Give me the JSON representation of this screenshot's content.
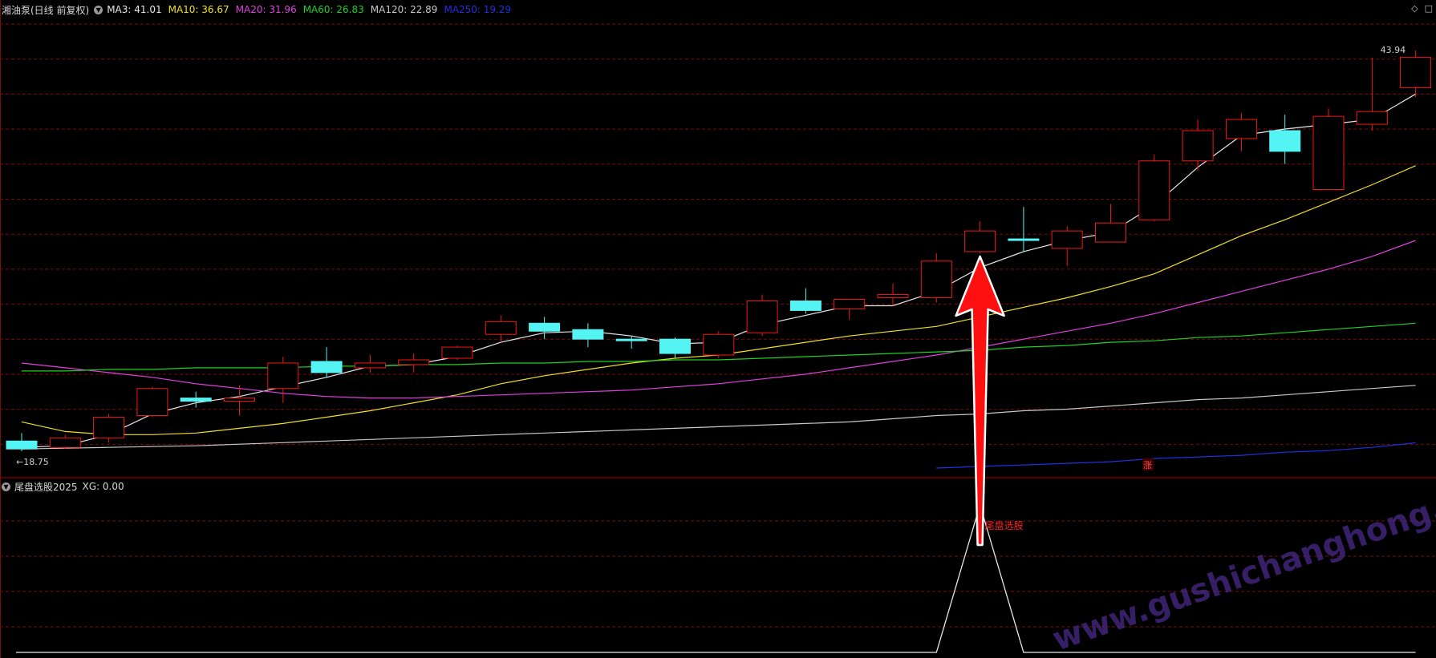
{
  "header": {
    "title": "湘油泵(日线 前复权)",
    "ma_labels": [
      {
        "name": "MA3",
        "value": "41.01",
        "color": "#e6e6e6"
      },
      {
        "name": "MA10",
        "value": "36.67",
        "color": "#f0e020"
      },
      {
        "name": "MA20",
        "value": "31.96",
        "color": "#e040e0"
      },
      {
        "name": "MA60",
        "value": "26.83",
        "color": "#20d020"
      },
      {
        "name": "MA120",
        "value": "22.89",
        "color": "#c8c8c8"
      },
      {
        "name": "MA250",
        "value": "19.29",
        "color": "#2030e0"
      }
    ]
  },
  "sub_panel": {
    "title": "尾盘选股2025",
    "xg_label": "XG: 0.00",
    "signal_text": "尾盘选股"
  },
  "annotations": {
    "high_label": "43.94",
    "low_label": "18.75",
    "rise_mark": "涨",
    "watermark": "www.gushichanghong.com"
  },
  "colors": {
    "up": "#f01818",
    "down": "#54f4f4",
    "grid": "#7a0a0a",
    "arrow": "#ff1010"
  },
  "chart_data": {
    "type": "candlestick",
    "ylim": [
      17.5,
      46
    ],
    "candles": [
      {
        "o": 19.4,
        "h": 19.9,
        "l": 18.75,
        "c": 18.9
      },
      {
        "o": 19.0,
        "h": 19.8,
        "l": 18.9,
        "c": 19.6
      },
      {
        "o": 19.6,
        "h": 21.1,
        "l": 19.3,
        "c": 20.9
      },
      {
        "o": 21.0,
        "h": 22.8,
        "l": 20.9,
        "c": 22.7
      },
      {
        "o": 22.1,
        "h": 22.5,
        "l": 21.5,
        "c": 21.9
      },
      {
        "o": 21.9,
        "h": 22.9,
        "l": 21.0,
        "c": 22.1
      },
      {
        "o": 22.7,
        "h": 24.7,
        "l": 21.8,
        "c": 24.3
      },
      {
        "o": 24.4,
        "h": 25.3,
        "l": 23.4,
        "c": 23.7
      },
      {
        "o": 24.0,
        "h": 24.8,
        "l": 23.7,
        "c": 24.3
      },
      {
        "o": 24.2,
        "h": 24.9,
        "l": 23.7,
        "c": 24.5
      },
      {
        "o": 24.6,
        "h": 25.4,
        "l": 24.5,
        "c": 25.3
      },
      {
        "o": 26.1,
        "h": 27.3,
        "l": 25.6,
        "c": 26.9
      },
      {
        "o": 26.8,
        "h": 27.2,
        "l": 25.8,
        "c": 26.3
      },
      {
        "o": 26.4,
        "h": 26.8,
        "l": 25.3,
        "c": 25.8
      },
      {
        "o": 25.8,
        "h": 26.0,
        "l": 25.2,
        "c": 25.7
      },
      {
        "o": 25.8,
        "h": 25.9,
        "l": 24.6,
        "c": 24.9
      },
      {
        "o": 24.8,
        "h": 26.3,
        "l": 24.6,
        "c": 26.1
      },
      {
        "o": 26.2,
        "h": 28.6,
        "l": 26.0,
        "c": 28.2
      },
      {
        "o": 28.2,
        "h": 29.0,
        "l": 27.4,
        "c": 27.6
      },
      {
        "o": 27.7,
        "h": 28.3,
        "l": 27.0,
        "c": 28.3
      },
      {
        "o": 28.4,
        "h": 29.3,
        "l": 27.9,
        "c": 28.6
      },
      {
        "o": 28.4,
        "h": 31.2,
        "l": 28.1,
        "c": 30.7
      },
      {
        "o": 31.3,
        "h": 33.2,
        "l": 31.2,
        "c": 32.6
      },
      {
        "o": 32.1,
        "h": 34.1,
        "l": 31.3,
        "c": 32.0
      },
      {
        "o": 31.5,
        "h": 32.9,
        "l": 30.4,
        "c": 32.6
      },
      {
        "o": 31.9,
        "h": 34.3,
        "l": 31.9,
        "c": 33.1
      },
      {
        "o": 33.3,
        "h": 37.4,
        "l": 33.2,
        "c": 37.0
      },
      {
        "o": 37.0,
        "h": 39.6,
        "l": 36.4,
        "c": 38.9
      },
      {
        "o": 38.4,
        "h": 40.0,
        "l": 37.6,
        "c": 39.6
      },
      {
        "o": 38.9,
        "h": 39.9,
        "l": 36.8,
        "c": 37.6
      },
      {
        "o": 35.2,
        "h": 40.3,
        "l": 35.2,
        "c": 39.8
      },
      {
        "o": 39.3,
        "h": 43.5,
        "l": 38.9,
        "c": 40.1
      },
      {
        "o": 41.6,
        "h": 43.94,
        "l": 41.0,
        "c": 43.5
      }
    ],
    "ma_series": [
      {
        "name": "MA3",
        "color": "#e6e6e6",
        "values": [
          19.0,
          19.1,
          19.8,
          21.1,
          21.8,
          22.2,
          22.8,
          23.4,
          24.1,
          24.2,
          24.7,
          25.6,
          26.2,
          26.3,
          26.0,
          25.5,
          25.6,
          26.7,
          27.3,
          27.9,
          27.9,
          28.8,
          30.3,
          31.3,
          32.0,
          32.5,
          34.2,
          36.6,
          38.6,
          39.0,
          39.3,
          39.6,
          41.2
        ]
      },
      {
        "name": "MA10",
        "color": "#f0e020",
        "values": [
          20.6,
          20.0,
          19.8,
          19.8,
          19.9,
          20.2,
          20.5,
          20.9,
          21.3,
          21.8,
          22.3,
          23.0,
          23.5,
          23.9,
          24.3,
          24.6,
          24.8,
          25.2,
          25.6,
          26.0,
          26.3,
          26.6,
          27.2,
          27.8,
          28.4,
          29.1,
          29.9,
          31.1,
          32.3,
          33.3,
          34.4,
          35.5,
          36.7
        ]
      },
      {
        "name": "MA20",
        "color": "#e040e0",
        "values": [
          24.3,
          24.0,
          23.7,
          23.4,
          23.0,
          22.7,
          22.4,
          22.2,
          22.1,
          22.1,
          22.2,
          22.3,
          22.4,
          22.5,
          22.6,
          22.8,
          23.0,
          23.3,
          23.6,
          24.0,
          24.4,
          24.8,
          25.3,
          25.8,
          26.3,
          26.8,
          27.4,
          28.1,
          28.8,
          29.5,
          30.2,
          31.0,
          32.0
        ]
      },
      {
        "name": "MA60",
        "color": "#20d020",
        "values": [
          23.8,
          23.8,
          23.9,
          23.9,
          24.0,
          24.0,
          24.0,
          24.1,
          24.1,
          24.2,
          24.2,
          24.3,
          24.3,
          24.4,
          24.4,
          24.5,
          24.5,
          24.6,
          24.7,
          24.8,
          24.9,
          25.0,
          25.1,
          25.3,
          25.4,
          25.6,
          25.7,
          25.9,
          26.0,
          26.2,
          26.4,
          26.6,
          26.8
        ]
      },
      {
        "name": "MA120",
        "color": "#c8c8c8",
        "values": [
          18.9,
          18.95,
          19.0,
          19.05,
          19.1,
          19.2,
          19.3,
          19.4,
          19.5,
          19.6,
          19.7,
          19.8,
          19.9,
          20.0,
          20.1,
          20.2,
          20.3,
          20.4,
          20.5,
          20.6,
          20.8,
          21.0,
          21.1,
          21.3,
          21.4,
          21.6,
          21.8,
          22.0,
          22.1,
          22.3,
          22.5,
          22.7,
          22.9
        ]
      },
      {
        "name": "MA250",
        "color": "#2030e0",
        "values": [
          null,
          null,
          null,
          null,
          null,
          null,
          null,
          null,
          null,
          null,
          null,
          null,
          null,
          null,
          null,
          null,
          null,
          null,
          null,
          null,
          null,
          17.7,
          17.8,
          17.9,
          18.0,
          18.1,
          18.3,
          18.4,
          18.5,
          18.7,
          18.8,
          19.0,
          19.29
        ]
      }
    ],
    "xg_signal": [
      0,
      0,
      0,
      0,
      0,
      0,
      0,
      0,
      0,
      0,
      0,
      0,
      0,
      0,
      0,
      0,
      0,
      0,
      0,
      0,
      0,
      0,
      1,
      0,
      0,
      0,
      0,
      0,
      0,
      0,
      0,
      0,
      0
    ]
  }
}
